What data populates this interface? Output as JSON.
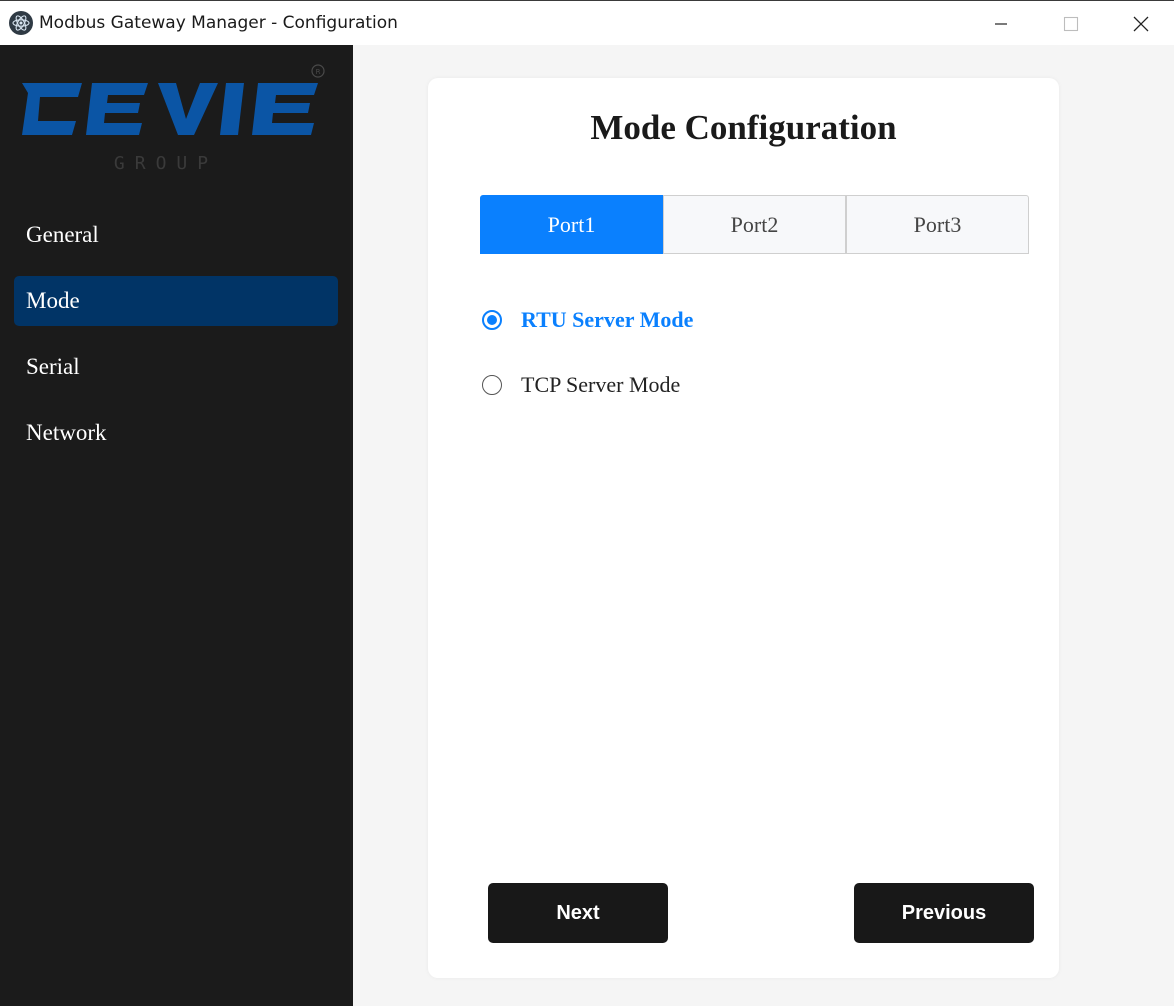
{
  "window": {
    "title": "Modbus Gateway Manager - Configuration",
    "icon": "electron-atom-icon",
    "controls": [
      "minimize-icon",
      "maximize-icon",
      "close-icon"
    ]
  },
  "sidebar": {
    "logo": {
      "wordmark": "CEVIE",
      "subtext": "GROUP",
      "mark": "®"
    },
    "items": [
      {
        "label": "General",
        "active": false
      },
      {
        "label": "Mode",
        "active": true
      },
      {
        "label": "Serial",
        "active": false
      },
      {
        "label": "Network",
        "active": false
      }
    ]
  },
  "main": {
    "title": "Mode Configuration",
    "tabs": [
      {
        "label": "Port1",
        "active": true
      },
      {
        "label": "Port2",
        "active": false
      },
      {
        "label": "Port3",
        "active": false
      }
    ],
    "modes": [
      {
        "label": "RTU Server Mode",
        "selected": true
      },
      {
        "label": "TCP Server Mode",
        "selected": false
      }
    ],
    "buttons": {
      "next": "Next",
      "previous": "Previous"
    }
  },
  "colors": {
    "sidebar_bg": "#1b1b1b",
    "nav_active": "#013466",
    "accent": "#0a80fe",
    "logo_blue": "#0b55a5",
    "button_bg": "#181818"
  }
}
